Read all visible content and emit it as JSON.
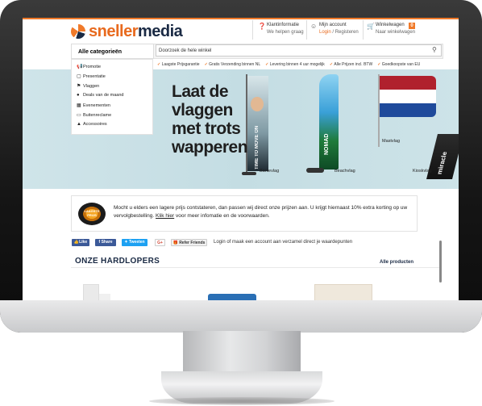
{
  "header": {
    "logo_part1": "sneller",
    "logo_part2": "media",
    "info_title": "Klantinformatie",
    "info_sub": "We helpen graag",
    "account_title": "Mijn account",
    "account_login": "Login",
    "account_sep": " / ",
    "account_register": "Registeren",
    "cart_title": "Winkelwagen",
    "cart_count": "0",
    "cart_sub": "Naar winkelwagen"
  },
  "nav": {
    "categories_label": "Alle categorieën",
    "search_placeholder": "Doorzoek de hele winkel"
  },
  "usps": [
    "Laagste Prijsgarantie",
    "Gratis Verzending binnen NL",
    "Levering binnen 4 uur mogelijk",
    "Alle Prijzen incl. BTW",
    "Goedkoopste van EU"
  ],
  "menu": [
    {
      "label": "Promotie",
      "icon": "megaphone-icon"
    },
    {
      "label": "Presentatie",
      "icon": "presentation-icon"
    },
    {
      "label": "Vlaggen",
      "icon": "flag-icon"
    },
    {
      "label": "Deals van de maand",
      "icon": "tag-icon"
    },
    {
      "label": "Evenementen",
      "icon": "calendar-icon"
    },
    {
      "label": "Buitenreclame",
      "icon": "billboard-icon"
    },
    {
      "label": "Accessoires",
      "icon": "accessory-icon"
    }
  ],
  "banner": {
    "title_l1": "Laat de",
    "title_l2": "vlaggen",
    "title_l3": "met trots",
    "title_l4": "wapperen",
    "flag1_text": "TIME TO MOVE ON",
    "flag1_label": "Banievlag",
    "flag2_text": "NOMAD",
    "flag2_label": "Beachvlag",
    "flag3_label": "Mastvlag",
    "flag4_text": "miracle",
    "flag4_label": "Kioskvlag"
  },
  "notice": {
    "seal_text": "LAAGSTE PRIJS",
    "text_main": "Mocht u elders een lagere prijs contstateren, dan passen wij direct onze prijzen aan. U krijgt hiernaast 10% extra korting op uw vervolgbestelling.",
    "link": "Klik hier",
    "text_after": " voor meer infomatie en de voorwaarden."
  },
  "social": {
    "like": "Like",
    "share": "Share",
    "tweet": "Tweeten",
    "gplus": "G+",
    "refer": "Refer Friends",
    "login_text": "Login of maak een account aan verzamel direct je waardepunten"
  },
  "section": {
    "title": "ONZE HARDLOPERS",
    "all_link": "Alle producten"
  },
  "colors": {
    "accent": "#f07a2a",
    "navy": "#1a2a44"
  }
}
